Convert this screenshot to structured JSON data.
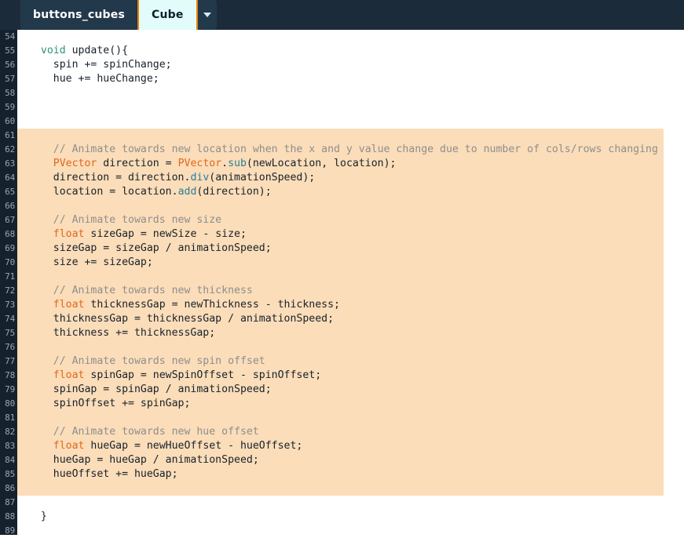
{
  "window": {
    "title": "Processing Editor - Cube tab"
  },
  "tabs": {
    "items": [
      {
        "label": "buttons_cubes",
        "active": false
      },
      {
        "label": "Cube",
        "active": true
      }
    ],
    "menu_icon": "chevron-down-icon",
    "accent_color": "#E8820C",
    "active_bg": "#E2FCFC",
    "bar_bg": "#1C2B3A"
  },
  "editor": {
    "gutter_bg": "#16212E",
    "gutter_fg": "#96A7B5",
    "selection_bg": "#FBDDB9",
    "first_line_number": 54,
    "last_line_number": 89,
    "selection_first_line": 61,
    "selection_last_line": 86,
    "lines": [
      {
        "n": 54,
        "hl": false,
        "tokens": []
      },
      {
        "n": 55,
        "hl": false,
        "tokens": [
          {
            "t": "  ",
            "c": ""
          },
          {
            "t": "void",
            "c": "kw"
          },
          {
            "t": " update(){",
            "c": ""
          }
        ]
      },
      {
        "n": 56,
        "hl": false,
        "tokens": [
          {
            "t": "    spin += spinChange;",
            "c": ""
          }
        ]
      },
      {
        "n": 57,
        "hl": false,
        "tokens": [
          {
            "t": "    hue += hueChange;",
            "c": ""
          }
        ]
      },
      {
        "n": 58,
        "hl": false,
        "tokens": []
      },
      {
        "n": 59,
        "hl": false,
        "tokens": []
      },
      {
        "n": 60,
        "hl": false,
        "tokens": []
      },
      {
        "n": 61,
        "hl": true,
        "tokens": []
      },
      {
        "n": 62,
        "hl": true,
        "tokens": [
          {
            "t": "    // Animate towards new location when the x and y value change due to number of cols/rows changing",
            "c": "cmt"
          }
        ]
      },
      {
        "n": 63,
        "hl": true,
        "tokens": [
          {
            "t": "    ",
            "c": ""
          },
          {
            "t": "PVector",
            "c": "type"
          },
          {
            "t": " direction = ",
            "c": ""
          },
          {
            "t": "PVector",
            "c": "type"
          },
          {
            "t": ".",
            "c": ""
          },
          {
            "t": "sub",
            "c": "fn"
          },
          {
            "t": "(newLocation, location);",
            "c": ""
          }
        ]
      },
      {
        "n": 64,
        "hl": true,
        "tokens": [
          {
            "t": "    direction = direction.",
            "c": ""
          },
          {
            "t": "div",
            "c": "fn"
          },
          {
            "t": "(animationSpeed);",
            "c": ""
          }
        ]
      },
      {
        "n": 65,
        "hl": true,
        "tokens": [
          {
            "t": "    location = location.",
            "c": ""
          },
          {
            "t": "add",
            "c": "fn"
          },
          {
            "t": "(direction);",
            "c": ""
          }
        ]
      },
      {
        "n": 66,
        "hl": true,
        "tokens": []
      },
      {
        "n": 67,
        "hl": true,
        "tokens": [
          {
            "t": "    // Animate towards new size",
            "c": "cmt"
          }
        ]
      },
      {
        "n": 68,
        "hl": true,
        "tokens": [
          {
            "t": "    ",
            "c": ""
          },
          {
            "t": "float",
            "c": "type"
          },
          {
            "t": " sizeGap = newSize - size;",
            "c": ""
          }
        ]
      },
      {
        "n": 69,
        "hl": true,
        "tokens": [
          {
            "t": "    sizeGap = sizeGap / animationSpeed;",
            "c": ""
          }
        ]
      },
      {
        "n": 70,
        "hl": true,
        "tokens": [
          {
            "t": "    size += sizeGap;",
            "c": ""
          }
        ]
      },
      {
        "n": 71,
        "hl": true,
        "tokens": []
      },
      {
        "n": 72,
        "hl": true,
        "tokens": [
          {
            "t": "    // Animate towards new thickness",
            "c": "cmt"
          }
        ]
      },
      {
        "n": 73,
        "hl": true,
        "tokens": [
          {
            "t": "    ",
            "c": ""
          },
          {
            "t": "float",
            "c": "type"
          },
          {
            "t": " thicknessGap = newThickness - thickness;",
            "c": ""
          }
        ]
      },
      {
        "n": 74,
        "hl": true,
        "tokens": [
          {
            "t": "    thicknessGap = thicknessGap / animationSpeed;",
            "c": ""
          }
        ]
      },
      {
        "n": 75,
        "hl": true,
        "tokens": [
          {
            "t": "    thickness += thicknessGap;",
            "c": ""
          }
        ]
      },
      {
        "n": 76,
        "hl": true,
        "tokens": []
      },
      {
        "n": 77,
        "hl": true,
        "tokens": [
          {
            "t": "    // Animate towards new spin offset",
            "c": "cmt"
          }
        ]
      },
      {
        "n": 78,
        "hl": true,
        "tokens": [
          {
            "t": "    ",
            "c": ""
          },
          {
            "t": "float",
            "c": "type"
          },
          {
            "t": " spinGap = newSpinOffset - spinOffset;",
            "c": ""
          }
        ]
      },
      {
        "n": 79,
        "hl": true,
        "tokens": [
          {
            "t": "    spinGap = spinGap / animationSpeed;",
            "c": ""
          }
        ]
      },
      {
        "n": 80,
        "hl": true,
        "tokens": [
          {
            "t": "    spinOffset += spinGap;",
            "c": ""
          }
        ]
      },
      {
        "n": 81,
        "hl": true,
        "tokens": []
      },
      {
        "n": 82,
        "hl": true,
        "tokens": [
          {
            "t": "    // Animate towards new hue offset",
            "c": "cmt"
          }
        ]
      },
      {
        "n": 83,
        "hl": true,
        "tokens": [
          {
            "t": "    ",
            "c": ""
          },
          {
            "t": "float",
            "c": "type"
          },
          {
            "t": " hueGap = newHueOffset - hueOffset;",
            "c": ""
          }
        ]
      },
      {
        "n": 84,
        "hl": true,
        "tokens": [
          {
            "t": "    hueGap = hueGap / animationSpeed;",
            "c": ""
          }
        ]
      },
      {
        "n": 85,
        "hl": true,
        "tokens": [
          {
            "t": "    hueOffset += hueGap;",
            "c": ""
          }
        ]
      },
      {
        "n": 86,
        "hl": true,
        "tokens": []
      },
      {
        "n": 87,
        "hl": false,
        "tokens": []
      },
      {
        "n": 88,
        "hl": false,
        "tokens": [
          {
            "t": "  }",
            "c": ""
          }
        ]
      },
      {
        "n": 89,
        "hl": false,
        "tokens": []
      }
    ]
  }
}
